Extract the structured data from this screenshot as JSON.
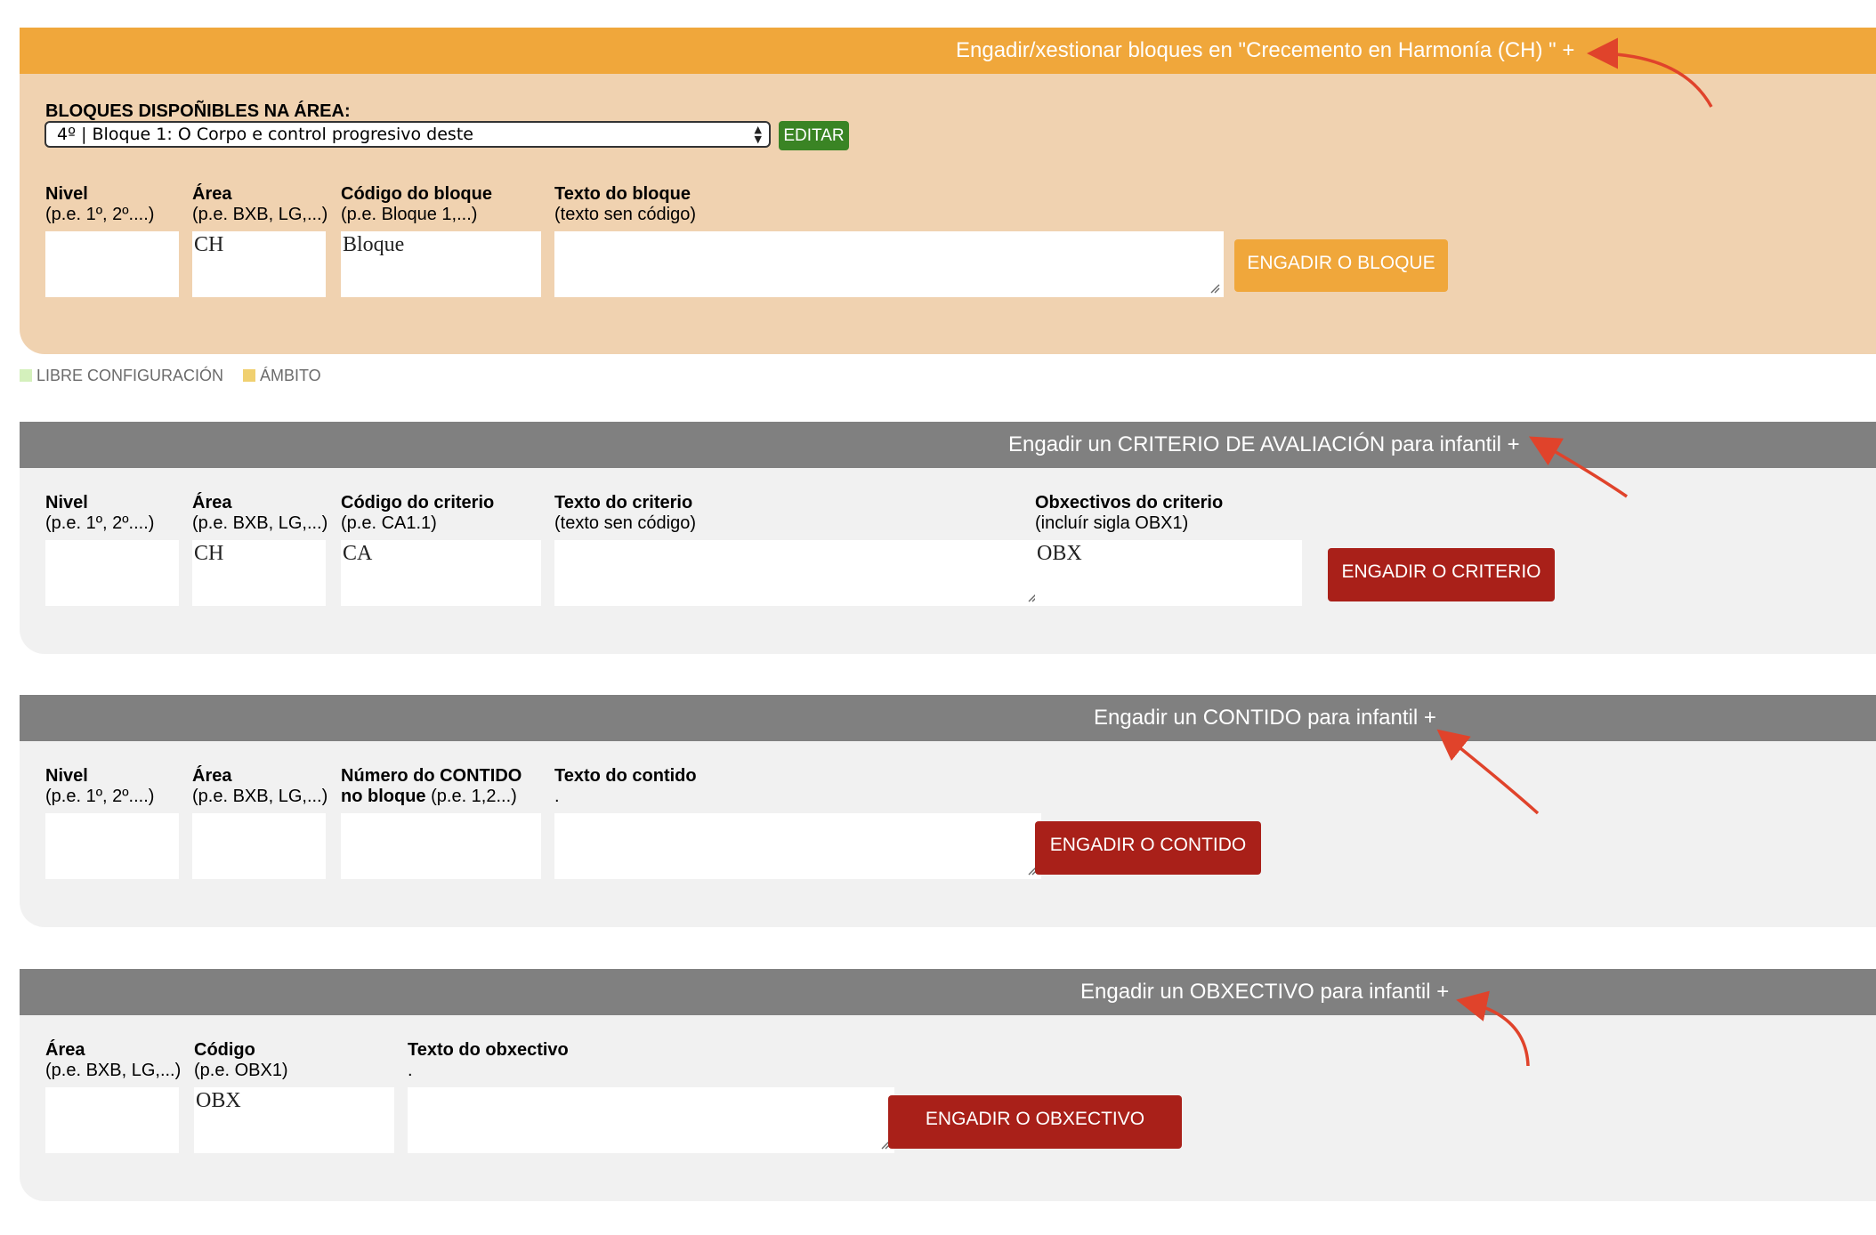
{
  "colors": {
    "orange_header": "#f0a73b",
    "orange_body": "#f0d2b0",
    "grey_header": "#808080",
    "grey_body": "#f1f1f1",
    "red_button": "#a92019",
    "green_button": "#3a8424",
    "annotation_arrow": "#e0432b",
    "libre_swatch": "#d4f0bc",
    "ambito_swatch": "#f0d070"
  },
  "bloques": {
    "header": "Engadir/xestionar bloques en \"Crecemento en Harmonía (CH) \" +",
    "available_label": "BLOQUES DISPOÑIBLES NA ÁREA:",
    "selected": "4º | Bloque 1: O Corpo e control progresivo deste",
    "edit_button": "EDITAR",
    "nivel_label": "Nivel",
    "nivel_hint": "(p.e. 1º, 2º....)",
    "area_label": "Área",
    "area_hint": "(p.e. BXB, LG,...)",
    "codigo_label": "Código do bloque",
    "codigo_hint": "(p.e. Bloque 1,...)",
    "texto_label": "Texto do bloque",
    "texto_hint": "(texto sen código)",
    "nivel_value": "",
    "area_value": "CH",
    "codigo_value": "Bloque",
    "texto_value": "",
    "submit": "ENGADIR O BLOQUE"
  },
  "legend": {
    "libre": "LIBRE CONFIGURACIÓN",
    "ambito": "ÁMBITO"
  },
  "criterio": {
    "header": "Engadir un CRITERIO DE AVALIACIÓN para infantil +",
    "nivel_label": "Nivel",
    "nivel_hint": "(p.e. 1º, 2º....)",
    "area_label": "Área",
    "area_hint": "(p.e. BXB, LG,...)",
    "codigo_label": "Código do criterio",
    "codigo_hint": "(p.e. CA1.1)",
    "texto_label": "Texto do criterio",
    "texto_hint": "(texto sen código)",
    "obx_label": "Obxectivos do criterio",
    "obx_hint": "(incluír sigla OBX1)",
    "nivel_value": "",
    "area_value": "CH",
    "codigo_value": "CA",
    "texto_value": "",
    "obx_value": "OBX",
    "submit": "ENGADIR O CRITERIO"
  },
  "contido": {
    "header": "Engadir un CONTIDO para infantil +",
    "nivel_label": "Nivel",
    "nivel_hint": "(p.e. 1º, 2º....)",
    "area_label": "Área",
    "area_hint": "(p.e. BXB, LG,...)",
    "numero_label_1": "Número do CONTIDO",
    "numero_label_2": "no bloque",
    "numero_hint": "(p.e. 1,2...)",
    "texto_label": "Texto do contido",
    "texto_hint": ".",
    "nivel_value": "",
    "area_value": "",
    "numero_value": "",
    "texto_value": "",
    "submit": "ENGADIR O CONTIDO"
  },
  "obxectivo": {
    "header": "Engadir un OBXECTIVO para infantil +",
    "area_label": "Área",
    "area_hint": "(p.e. BXB, LG,...)",
    "codigo_label": "Código",
    "codigo_hint": "(p.e. OBX1)",
    "texto_label": "Texto do obxectivo",
    "texto_hint": ".",
    "area_value": "",
    "codigo_value": "OBX",
    "texto_value": "",
    "submit": "ENGADIR O OBXECTIVO"
  }
}
